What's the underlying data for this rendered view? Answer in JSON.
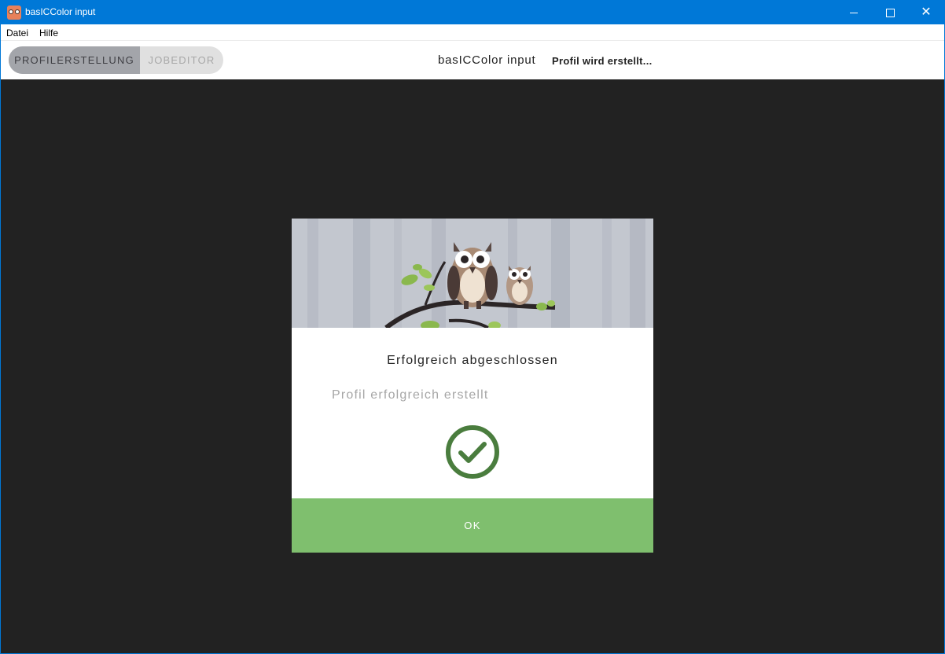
{
  "window": {
    "title": "basICColor input"
  },
  "menu": {
    "items": [
      "Datei",
      "Hilfe"
    ]
  },
  "toolbar": {
    "tab_profil": "PROFILERSTELLUNG",
    "tab_job": "JOBEDITOR",
    "app_name": "basICColor input",
    "status": "Profil wird erstellt..."
  },
  "dialog": {
    "title": "Erfolgreich abgeschlossen",
    "message": "Profil erfolgreich erstellt",
    "ok_label": "OK"
  },
  "colors": {
    "titlebar": "#0078d7",
    "background": "#222222",
    "ok_button": "#7fbf6e",
    "check": "#4a7d3e"
  }
}
